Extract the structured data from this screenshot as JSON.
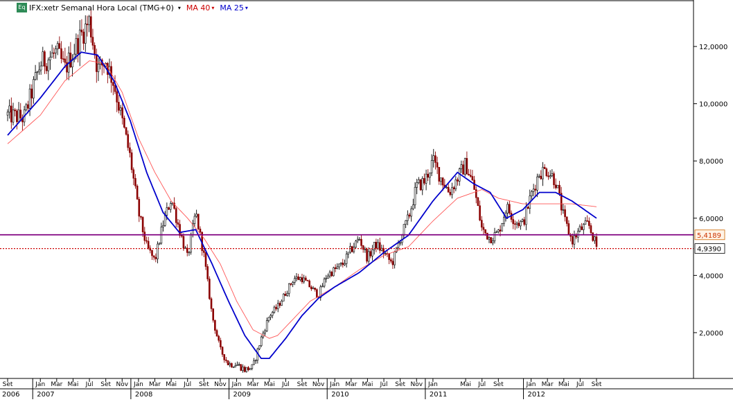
{
  "header": {
    "badge": "Eq",
    "title": "IFX:xetr Semanal Hora Local (TMG+0)",
    "ma40_label": "MA 40",
    "ma25_label": "MA 25",
    "dropdown_glyph": "▾"
  },
  "colors": {
    "up_candle": "#000000",
    "down_candle": "#8b0000",
    "ma40": "#ff5555",
    "ma25": "#0000cc",
    "support_line": "#800080",
    "last_price_line": "#cc0000",
    "badge": "#2e8b57"
  },
  "chart_data": {
    "type": "candlestick",
    "y_axis_side": "right",
    "ylim": [
      0.4,
      13.6
    ],
    "y_ticks": [
      "2,0000",
      "4,0000",
      "6,0000",
      "8,0000",
      "10,0000",
      "12,0000"
    ],
    "y_tick_values": [
      2,
      4,
      6,
      8,
      10,
      12
    ],
    "grid": false,
    "x_month_labels": [
      "Set",
      "Jan",
      "Mar",
      "Mai",
      "Jul",
      "Set",
      "Nov",
      "Jan",
      "Mar",
      "Mai",
      "Jul",
      "Set",
      "Nov",
      "Jan",
      "Mar",
      "Mai",
      "Jul",
      "Set",
      "Nov",
      "Jan",
      "Mar",
      "Mai",
      "Jul",
      "Set",
      "Nov",
      "Jan",
      "Mai",
      "Jul",
      "Set",
      "Jan",
      "Mar",
      "Mai",
      "Jul",
      "Set"
    ],
    "x_month_dates": [
      "2006-09",
      "2007-01",
      "2007-03",
      "2007-05",
      "2007-07",
      "2007-09",
      "2007-11",
      "2008-01",
      "2008-03",
      "2008-05",
      "2008-07",
      "2008-09",
      "2008-11",
      "2009-01",
      "2009-03",
      "2009-05",
      "2009-07",
      "2009-09",
      "2009-11",
      "2010-01",
      "2010-03",
      "2010-05",
      "2010-07",
      "2010-09",
      "2010-11",
      "2011-01",
      "2011-05",
      "2011-07",
      "2011-09",
      "2012-01",
      "2012-03",
      "2012-05",
      "2012-07",
      "2012-09"
    ],
    "x_year_labels": [
      "2006",
      "2007",
      "2008",
      "2009",
      "2010",
      "2011",
      "2012"
    ],
    "x_year_dates": [
      "2006-09",
      "2007-01",
      "2008-01",
      "2009-01",
      "2010-01",
      "2011-01",
      "2012-01"
    ],
    "series": [
      {
        "name": "IFX:xetr",
        "kind": "price",
        "points": [
          [
            "2006-09",
            9.6
          ],
          [
            "2006-11",
            9.5
          ],
          [
            "2007-01",
            11.4
          ],
          [
            "2007-03",
            11.8
          ],
          [
            "2007-04",
            11.2
          ],
          [
            "2007-06",
            12.4
          ],
          [
            "2007-07",
            12.9
          ],
          [
            "2007-08",
            11.2
          ],
          [
            "2007-09",
            11.5
          ],
          [
            "2007-10",
            10.7
          ],
          [
            "2007-11",
            9.4
          ],
          [
            "2007-12",
            8.1
          ],
          [
            "2008-01",
            6.2
          ],
          [
            "2008-02",
            5.0
          ],
          [
            "2008-03",
            4.5
          ],
          [
            "2008-04",
            5.8
          ],
          [
            "2008-05",
            6.7
          ],
          [
            "2008-06",
            5.6
          ],
          [
            "2008-07",
            4.6
          ],
          [
            "2008-08",
            6.2
          ],
          [
            "2008-09",
            4.7
          ],
          [
            "2008-10",
            2.6
          ],
          [
            "2008-11",
            1.4
          ],
          [
            "2008-12",
            0.9
          ],
          [
            "2009-01",
            0.9
          ],
          [
            "2009-02",
            0.7
          ],
          [
            "2009-03",
            0.8
          ],
          [
            "2009-04",
            1.8
          ],
          [
            "2009-05",
            2.6
          ],
          [
            "2009-06",
            2.9
          ],
          [
            "2009-07",
            3.4
          ],
          [
            "2009-08",
            3.9
          ],
          [
            "2009-09",
            3.9
          ],
          [
            "2009-10",
            3.6
          ],
          [
            "2009-11",
            3.3
          ],
          [
            "2009-12",
            4.0
          ],
          [
            "2010-01",
            4.2
          ],
          [
            "2010-02",
            4.4
          ],
          [
            "2010-03",
            4.9
          ],
          [
            "2010-04",
            5.3
          ],
          [
            "2010-05",
            4.6
          ],
          [
            "2010-06",
            5.1
          ],
          [
            "2010-07",
            4.8
          ],
          [
            "2010-08",
            4.4
          ],
          [
            "2010-09",
            5.3
          ],
          [
            "2010-10",
            6.0
          ],
          [
            "2010-11",
            7.1
          ],
          [
            "2010-12",
            7.3
          ],
          [
            "2011-01",
            8.0
          ],
          [
            "2011-02",
            7.4
          ],
          [
            "2011-03",
            6.9
          ],
          [
            "2011-04",
            7.4
          ],
          [
            "2011-05",
            7.9
          ],
          [
            "2011-06",
            7.1
          ],
          [
            "2011-07",
            5.6
          ],
          [
            "2011-08",
            5.3
          ],
          [
            "2011-09",
            5.5
          ],
          [
            "2011-10",
            6.4
          ],
          [
            "2011-11",
            5.9
          ],
          [
            "2011-12",
            5.8
          ],
          [
            "2012-01",
            6.8
          ],
          [
            "2012-02",
            7.6
          ],
          [
            "2012-03",
            7.7
          ],
          [
            "2012-04",
            7.3
          ],
          [
            "2012-05",
            6.0
          ],
          [
            "2012-06",
            5.2
          ],
          [
            "2012-07",
            5.6
          ],
          [
            "2012-08",
            5.8
          ],
          [
            "2012-09",
            5.0
          ]
        ]
      },
      {
        "name": "MA 40",
        "kind": "line",
        "points": [
          [
            "2006-09",
            8.6
          ],
          [
            "2007-01",
            9.6
          ],
          [
            "2007-04",
            10.8
          ],
          [
            "2007-07",
            11.5
          ],
          [
            "2007-09",
            11.4
          ],
          [
            "2007-11",
            10.4
          ],
          [
            "2008-01",
            8.8
          ],
          [
            "2008-03",
            7.6
          ],
          [
            "2008-05",
            6.6
          ],
          [
            "2008-07",
            6.0
          ],
          [
            "2008-09",
            5.3
          ],
          [
            "2008-11",
            4.4
          ],
          [
            "2009-01",
            3.1
          ],
          [
            "2009-03",
            2.1
          ],
          [
            "2009-05",
            1.8
          ],
          [
            "2009-06",
            1.9
          ],
          [
            "2009-08",
            2.5
          ],
          [
            "2009-10",
            3.1
          ],
          [
            "2010-01",
            3.6
          ],
          [
            "2010-04",
            4.2
          ],
          [
            "2010-07",
            4.7
          ],
          [
            "2010-10",
            5.0
          ],
          [
            "2011-01",
            5.9
          ],
          [
            "2011-04",
            6.7
          ],
          [
            "2011-07",
            7.0
          ],
          [
            "2011-09",
            6.7
          ],
          [
            "2011-12",
            6.5
          ],
          [
            "2012-03",
            6.5
          ],
          [
            "2012-06",
            6.5
          ],
          [
            "2012-09",
            6.4
          ]
        ]
      },
      {
        "name": "MA 25",
        "kind": "line",
        "points": [
          [
            "2006-09",
            8.9
          ],
          [
            "2007-01",
            10.2
          ],
          [
            "2007-04",
            11.3
          ],
          [
            "2007-06",
            11.8
          ],
          [
            "2007-08",
            11.7
          ],
          [
            "2007-10",
            10.8
          ],
          [
            "2007-12",
            9.4
          ],
          [
            "2008-02",
            7.6
          ],
          [
            "2008-04",
            6.2
          ],
          [
            "2008-06",
            5.5
          ],
          [
            "2008-08",
            5.6
          ],
          [
            "2008-10",
            4.4
          ],
          [
            "2008-12",
            3.1
          ],
          [
            "2009-02",
            1.9
          ],
          [
            "2009-04",
            1.1
          ],
          [
            "2009-05",
            1.1
          ],
          [
            "2009-07",
            1.8
          ],
          [
            "2009-09",
            2.6
          ],
          [
            "2009-11",
            3.2
          ],
          [
            "2010-01",
            3.6
          ],
          [
            "2010-04",
            4.1
          ],
          [
            "2010-07",
            4.8
          ],
          [
            "2010-10",
            5.4
          ],
          [
            "2011-01",
            6.6
          ],
          [
            "2011-04",
            7.6
          ],
          [
            "2011-06",
            7.2
          ],
          [
            "2011-08",
            6.9
          ],
          [
            "2011-10",
            6.0
          ],
          [
            "2011-12",
            6.3
          ],
          [
            "2012-02",
            6.9
          ],
          [
            "2012-04",
            6.9
          ],
          [
            "2012-06",
            6.6
          ],
          [
            "2012-09",
            6.0
          ]
        ]
      }
    ],
    "horizontal_lines": [
      {
        "value": 5.4189,
        "label": "5,4189",
        "style": "solid"
      },
      {
        "value": 4.939,
        "label": "4,9390",
        "style": "dotted"
      }
    ]
  }
}
